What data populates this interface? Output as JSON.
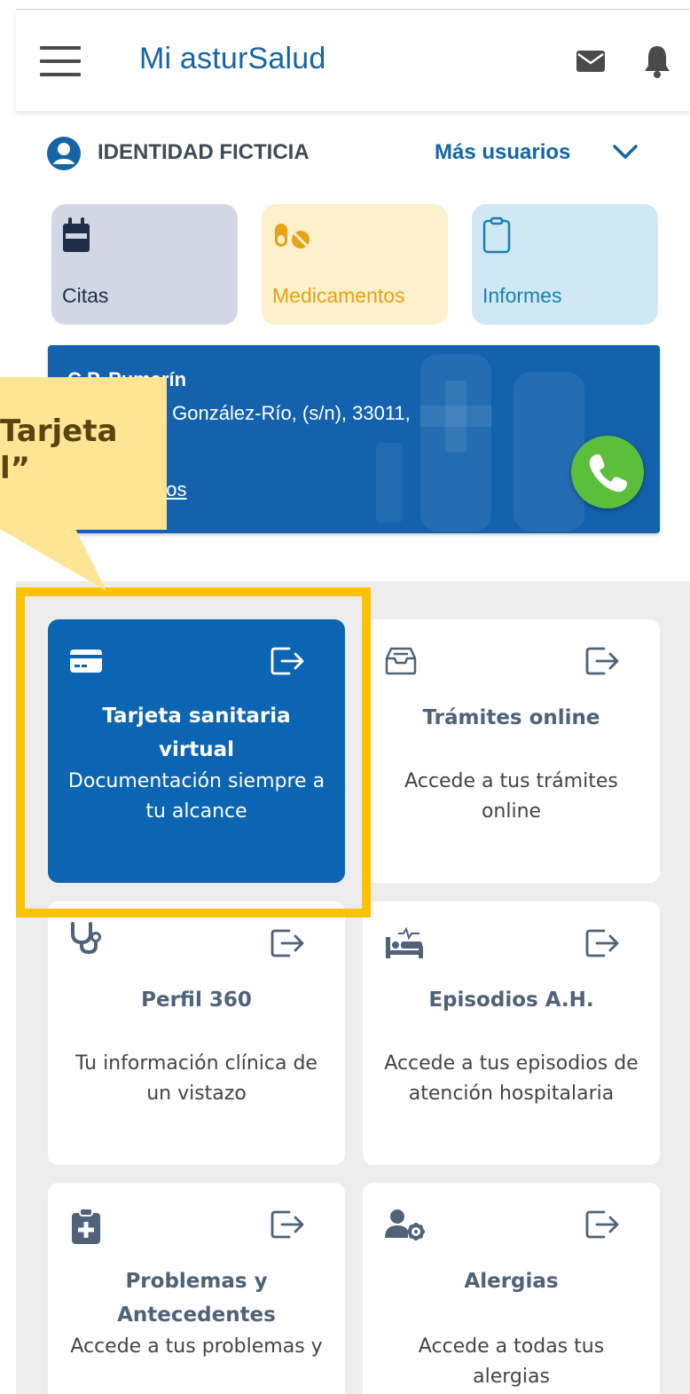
{
  "header": {
    "title": "Mi asturSalud",
    "icons": [
      "menu-icon",
      "mail-icon",
      "bell-icon"
    ]
  },
  "user": {
    "name": "IDENTIDAD FICTICIA",
    "more_users_label": "Más usuarios"
  },
  "quick_access": [
    {
      "label": "Citas",
      "icon": "calendar-icon",
      "color": "#d3d7e5"
    },
    {
      "label": "Medicamentos",
      "icon": "pills-icon",
      "color": "#fdf0cc"
    },
    {
      "label": "Informes",
      "icon": "clipboard-icon",
      "color": "#cfe8f4"
    }
  ],
  "health_center": {
    "name": "C.P. Pumarín",
    "address": "…mira Villa González-Río, (s/n), 33011,",
    "link": "…a Mis datos"
  },
  "callout": {
    "text": "Tarjeta\nl”"
  },
  "services": [
    {
      "title": "Tarjeta sanitaria virtual",
      "description": "Documentación siempre a tu alcance",
      "icon": "card-icon",
      "active": true
    },
    {
      "title": "Trámites online",
      "description": "Accede a tus trámites online",
      "icon": "inbox-icon"
    },
    {
      "title": "Perfil 360",
      "description": "Tu información clínica de un vistazo",
      "icon": "stethoscope-icon"
    },
    {
      "title": "Episodios A.H.",
      "description": "Accede a tus episodios de atención hospitalaria",
      "icon": "hospital-bed-icon"
    },
    {
      "title": "Problemas y Antecedentes",
      "description": "Accede a tus problemas y",
      "icon": "medical-clipboard-icon"
    },
    {
      "title": "Alergias",
      "description": "Accede a todas tus alergias",
      "icon": "user-gear-icon"
    }
  ],
  "colors": {
    "brand_blue": "#1565a6",
    "highlight": "#fcc200",
    "callout_bg": "#fde593",
    "phone_green": "#5bbf3c"
  }
}
